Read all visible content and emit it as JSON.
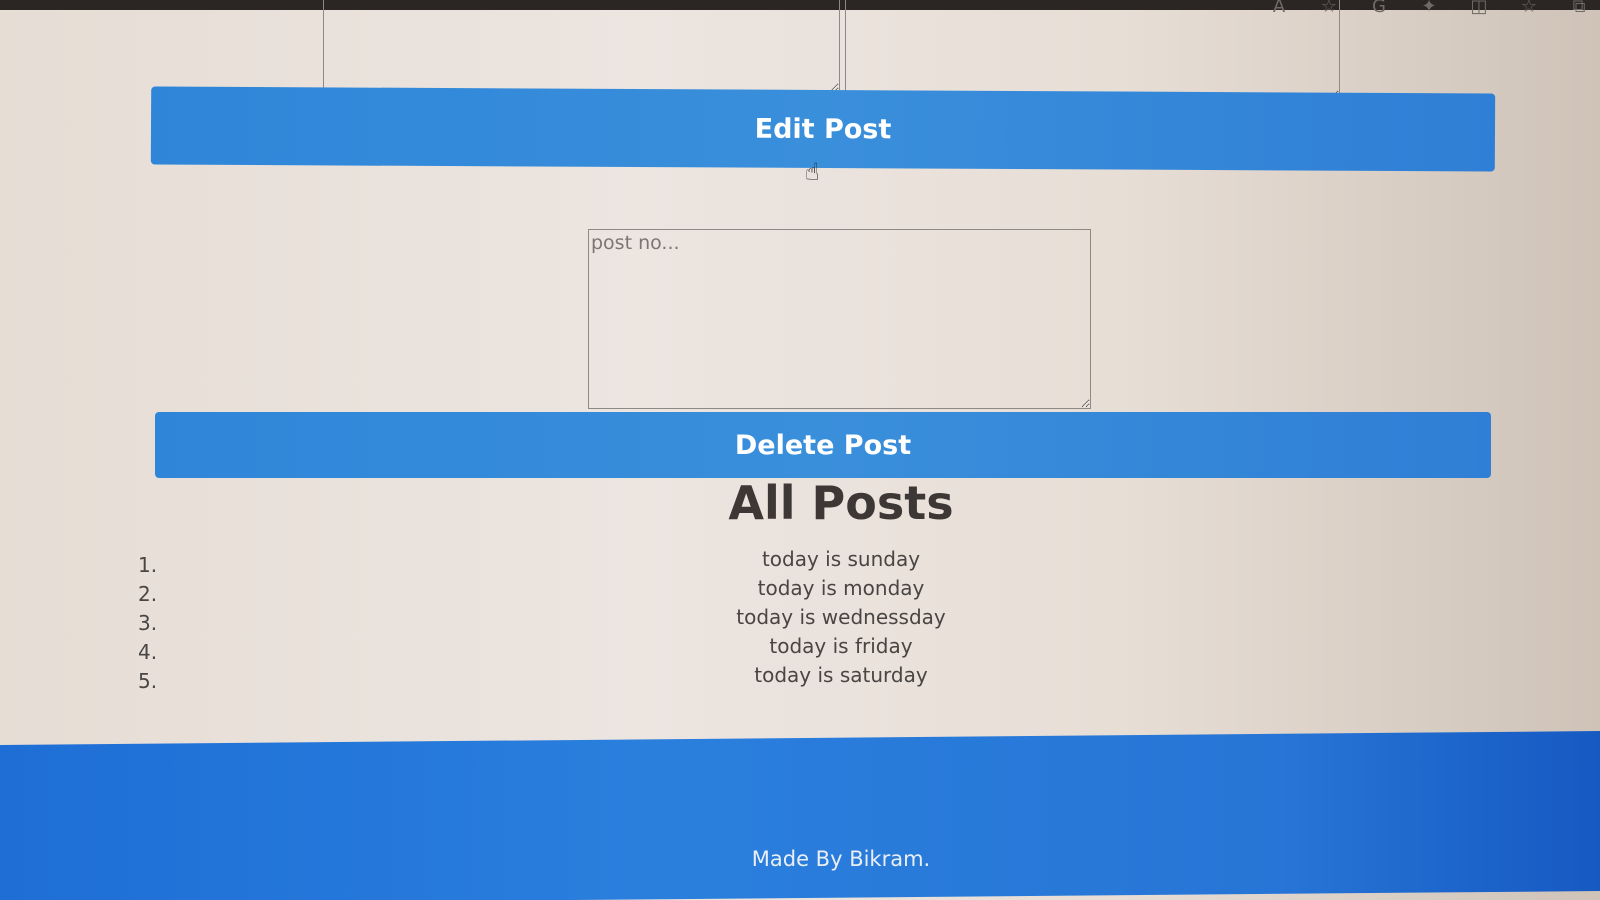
{
  "browser_toolbar": {
    "icons": [
      "read-aloud-icon",
      "favorite-star-icon",
      "grammarly-icon",
      "extensions-icon",
      "split-screen-icon",
      "favorites-list-icon",
      "collections-icon"
    ]
  },
  "forms": {
    "top_left_textarea_value": "",
    "top_right_textarea_value": "",
    "edit_post_label": "Edit Post",
    "post_no_placeholder": "post no...",
    "delete_post_label": "Delete Post"
  },
  "posts": {
    "title": "All Posts",
    "items": [
      {
        "number": "1.",
        "text": "today is sunday"
      },
      {
        "number": "2.",
        "text": "today is monday"
      },
      {
        "number": "3.",
        "text": "today is wednessday"
      },
      {
        "number": "4.",
        "text": "today is friday"
      },
      {
        "number": "5.",
        "text": "today is saturday"
      }
    ]
  },
  "footer": {
    "text": "Made By Bikram."
  },
  "colors": {
    "button_blue": "#3a8fdb",
    "footer_blue": "#2a7fdd",
    "title_text": "#3d3835"
  }
}
